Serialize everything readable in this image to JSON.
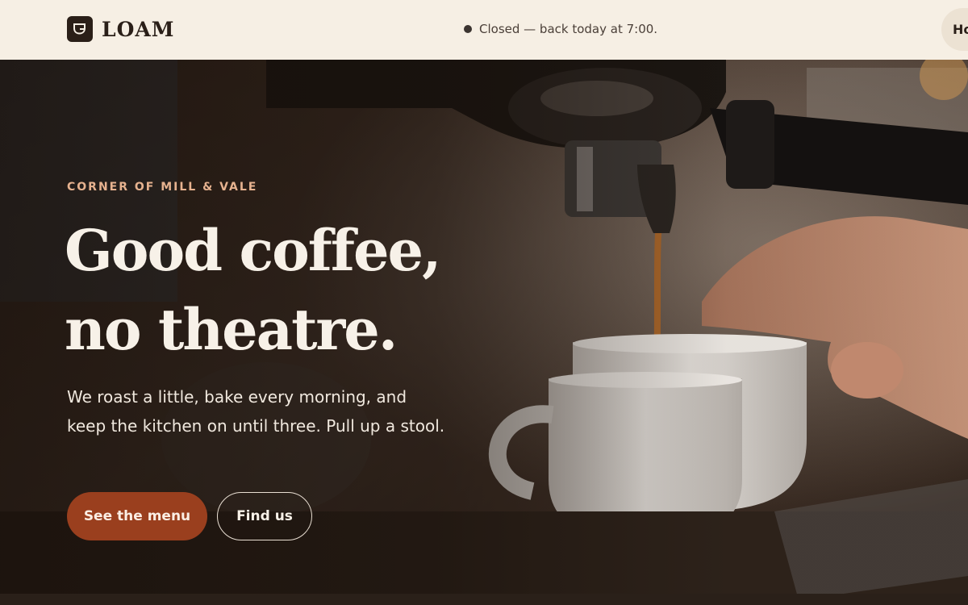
{
  "header": {
    "brand_name": "LOAM",
    "logo_icon": "coffee-cup-icon",
    "status_text": "Closed — back today at 7:00.",
    "nav_label": "Ho"
  },
  "hero": {
    "eyebrow": "CORNER OF MILL & VALE",
    "headline": "Good coffee, no theatre.",
    "lede": "We roast a little, bake every morning, and keep the kitchen on until three. Pull up a stool.",
    "primary_cta": "See the menu",
    "secondary_cta": "Find us",
    "photo": "espresso-pouring-into-cups"
  },
  "colors": {
    "header_bg": "#f6efe4",
    "accent": "#9a3f1e",
    "eyebrow": "#e6b28f",
    "text_light": "#f7f1e8"
  }
}
